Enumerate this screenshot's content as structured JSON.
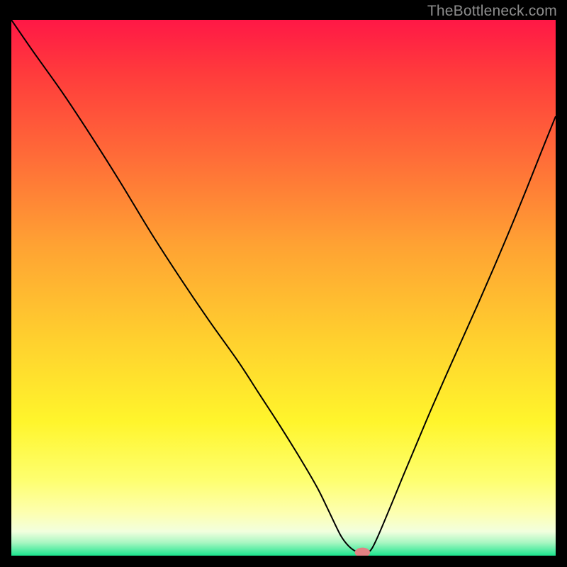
{
  "watermark": "TheBottleneck.com",
  "chart_data": {
    "type": "line",
    "title": "",
    "xlabel": "",
    "ylabel": "",
    "xlim": [
      0,
      100
    ],
    "ylim": [
      0,
      100
    ],
    "grid": false,
    "background_gradient_stops": [
      {
        "offset": 0.0,
        "color": "#ff1846"
      },
      {
        "offset": 0.1,
        "color": "#ff3b3c"
      },
      {
        "offset": 0.25,
        "color": "#ff6a38"
      },
      {
        "offset": 0.42,
        "color": "#ffa233"
      },
      {
        "offset": 0.6,
        "color": "#ffd12e"
      },
      {
        "offset": 0.75,
        "color": "#fff52c"
      },
      {
        "offset": 0.86,
        "color": "#feff70"
      },
      {
        "offset": 0.92,
        "color": "#fdffb0"
      },
      {
        "offset": 0.955,
        "color": "#f2ffde"
      },
      {
        "offset": 0.975,
        "color": "#acf7c3"
      },
      {
        "offset": 1.0,
        "color": "#1be58e"
      }
    ],
    "curve_points_internal": [
      [
        0.0,
        0.0
      ],
      [
        4.0,
        5.9
      ],
      [
        9.4,
        13.6
      ],
      [
        14.8,
        21.9
      ],
      [
        20.2,
        30.6
      ],
      [
        25.5,
        39.5
      ],
      [
        30.9,
        48.0
      ],
      [
        36.3,
        56.1
      ],
      [
        41.7,
        63.8
      ],
      [
        45.6,
        69.9
      ],
      [
        49.5,
        76.0
      ],
      [
        53.4,
        82.4
      ],
      [
        56.2,
        87.3
      ],
      [
        58.0,
        91.0
      ],
      [
        59.5,
        94.2
      ],
      [
        60.6,
        96.4
      ],
      [
        61.6,
        97.8
      ],
      [
        62.5,
        98.7
      ],
      [
        63.3,
        99.2
      ],
      [
        64.1,
        99.4
      ],
      [
        65.0,
        99.4
      ],
      [
        65.6,
        99.3
      ],
      [
        66.0,
        99.0
      ],
      [
        66.5,
        98.2
      ],
      [
        67.3,
        96.5
      ],
      [
        68.4,
        93.9
      ],
      [
        70.0,
        90.0
      ],
      [
        71.9,
        85.3
      ],
      [
        74.3,
        79.5
      ],
      [
        77.0,
        73.0
      ],
      [
        79.8,
        66.5
      ],
      [
        82.7,
        59.9
      ],
      [
        85.7,
        53.1
      ],
      [
        88.7,
        46.1
      ],
      [
        91.7,
        38.9
      ],
      [
        94.6,
        31.7
      ],
      [
        97.3,
        24.8
      ],
      [
        100.0,
        18.0
      ]
    ],
    "marker": {
      "x": 64.5,
      "y": 99.4,
      "rx": 1.4,
      "ry": 0.9,
      "color": "#e18184"
    }
  }
}
